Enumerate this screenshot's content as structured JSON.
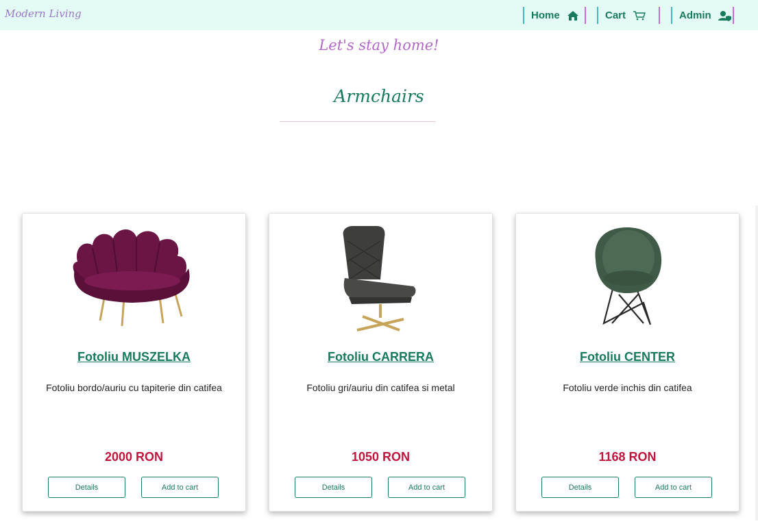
{
  "brand": "Modern Living",
  "nav": {
    "home": "Home",
    "cart": "Cart",
    "admin": "Admin"
  },
  "tagline": "Let's stay home!",
  "page_title": "Armchairs",
  "products": [
    {
      "name": "Fotoliu MUSZELKA",
      "description": "Fotoliu bordo/auriu cu tapiterie din catifea",
      "price": "2000 RON",
      "details_label": "Details",
      "cart_label": "Add to cart"
    },
    {
      "name": "Fotoliu CARRERA",
      "description": "Fotoliu gri/auriu din catifea si metal",
      "price": "1050 RON",
      "details_label": "Details",
      "cart_label": "Add to cart"
    },
    {
      "name": "Fotoliu CENTER",
      "description": "Fotoliu verde inchis din catifea",
      "price": "1168 RON",
      "details_label": "Details",
      "cart_label": "Add to cart"
    }
  ],
  "colors": {
    "nav_bg": "#e3fbf4",
    "accent_green": "#187a5c",
    "price_red": "#c0143c",
    "tagline_purple": "#b266c8"
  }
}
